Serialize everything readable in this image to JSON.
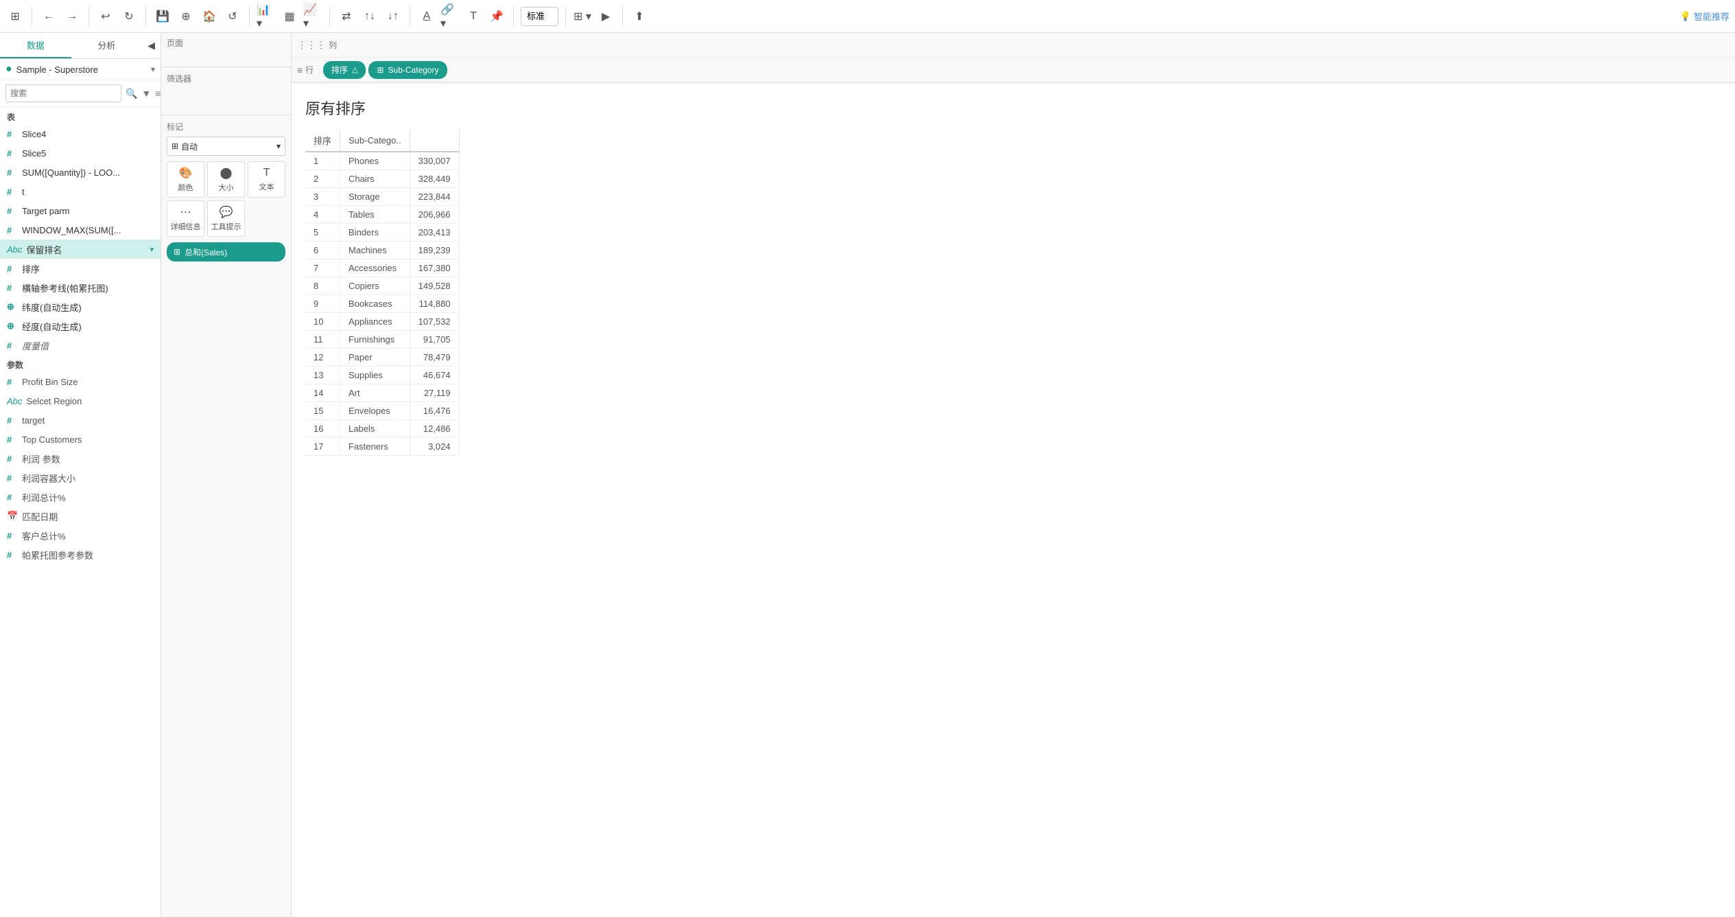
{
  "toolbar": {
    "back_label": "←",
    "forward_label": "→",
    "undo_label": "↩",
    "redo_icon": "↪",
    "save_icon": "💾",
    "add_datasource_icon": "+",
    "show_startpage_icon": "⊞",
    "refresh_icon": "↺",
    "chart_icon": "📊",
    "bars_icon": "▦",
    "lines_icon": "📈",
    "swap_icon": "⇄",
    "sort_asc_icon": "↑",
    "sort_desc_icon": "↓",
    "highlight_icon": "A",
    "link_icon": "🔗",
    "text_icon": "T",
    "pin_icon": "📌",
    "view_label": "标准",
    "grid_icon": "⊞",
    "present_icon": "▶",
    "share_icon": "⬆",
    "smart_recommend": "智能推荐"
  },
  "left_panel": {
    "tab_data": "数据",
    "tab_analysis": "分析",
    "collapse_icon": "◀",
    "search_placeholder": "搜索",
    "datasource": {
      "name": "Sample - Superstore",
      "icon": "●"
    },
    "section_table": "表",
    "fields": [
      {
        "type": "hash",
        "label": "Slice4"
      },
      {
        "type": "hash",
        "label": "Slice5"
      },
      {
        "type": "hash",
        "label": "SUM([Quantity]) - LOO..."
      },
      {
        "type": "hash",
        "label": "t"
      },
      {
        "type": "hash",
        "label": "Target parm"
      },
      {
        "type": "hash",
        "label": "WINDOW_MAX(SUM([..."
      },
      {
        "type": "abc",
        "label": "保留排名",
        "selected": true
      },
      {
        "type": "hash",
        "label": "排序"
      },
      {
        "type": "hash",
        "label": "横轴参考线(帕累托图)"
      },
      {
        "type": "globe",
        "label": "纬度(自动生成)"
      },
      {
        "type": "globe",
        "label": "经度(自动生成)"
      },
      {
        "type": "hash",
        "label": "度量值",
        "italic": true
      }
    ],
    "section_params": "参数",
    "params": [
      {
        "type": "hash",
        "label": "Profit Bin Size"
      },
      {
        "type": "abc",
        "label": "Selcet Region"
      },
      {
        "type": "hash",
        "label": "target"
      },
      {
        "type": "hash",
        "label": "Top Customers"
      },
      {
        "type": "hash",
        "label": "利润 参数"
      },
      {
        "type": "hash",
        "label": "利润容器大小"
      },
      {
        "type": "hash",
        "label": "利润总计%"
      },
      {
        "type": "calendar",
        "label": "匹配日期"
      },
      {
        "type": "hash",
        "label": "客户总计%"
      },
      {
        "type": "hash",
        "label": "帕累托图参考参数"
      }
    ]
  },
  "center_panel": {
    "page_label": "页面",
    "filter_label": "筛选器",
    "marks_label": "标记",
    "marks_type": "自动",
    "mark_btns": [
      {
        "icon": "🎨",
        "label": "颜色"
      },
      {
        "icon": "⬤",
        "label": "大小"
      },
      {
        "icon": "T",
        "label": "文本"
      },
      {
        "icon": "⋯",
        "label": "详细信息"
      },
      {
        "icon": "💬",
        "label": "工具提示"
      }
    ],
    "pill_label": "总和(Sales)"
  },
  "shelves": {
    "col_label": "列",
    "row_label": "行",
    "row_pills": [
      {
        "label": "排序",
        "type": "discrete",
        "warning": "△"
      },
      {
        "label": "Sub-Category",
        "type": "discrete"
      }
    ]
  },
  "view": {
    "title": "原有排序",
    "table_headers": [
      "排序",
      "Sub-Catego..",
      ""
    ],
    "rows": [
      {
        "rank": "1",
        "name": "Phones",
        "value": "330,007"
      },
      {
        "rank": "2",
        "name": "Chairs",
        "value": "328,449"
      },
      {
        "rank": "3",
        "name": "Storage",
        "value": "223,844"
      },
      {
        "rank": "4",
        "name": "Tables",
        "value": "206,966"
      },
      {
        "rank": "5",
        "name": "Binders",
        "value": "203,413"
      },
      {
        "rank": "6",
        "name": "Machines",
        "value": "189,239"
      },
      {
        "rank": "7",
        "name": "Accessories",
        "value": "167,380"
      },
      {
        "rank": "8",
        "name": "Copiers",
        "value": "149,528"
      },
      {
        "rank": "9",
        "name": "Bookcases",
        "value": "114,880"
      },
      {
        "rank": "10",
        "name": "Appliances",
        "value": "107,532"
      },
      {
        "rank": "11",
        "name": "Furnishings",
        "value": "91,705"
      },
      {
        "rank": "12",
        "name": "Paper",
        "value": "78,479"
      },
      {
        "rank": "13",
        "name": "Supplies",
        "value": "46,674"
      },
      {
        "rank": "14",
        "name": "Art",
        "value": "27,119"
      },
      {
        "rank": "15",
        "name": "Envelopes",
        "value": "16,476"
      },
      {
        "rank": "16",
        "name": "Labels",
        "value": "12,486"
      },
      {
        "rank": "17",
        "name": "Fasteners",
        "value": "3,024"
      }
    ]
  }
}
